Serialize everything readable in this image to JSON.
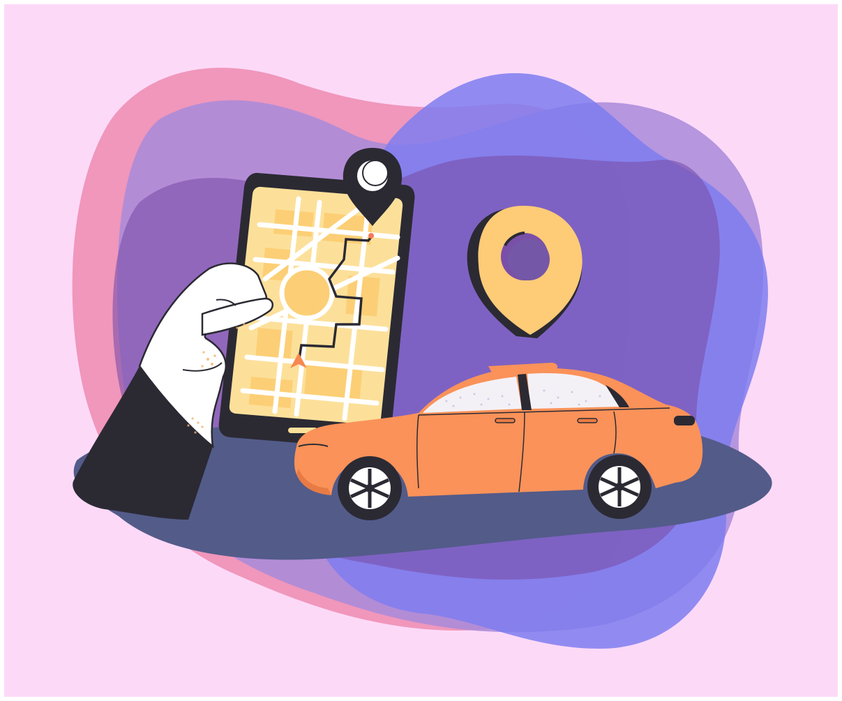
{
  "illustration": {
    "subject": "taxi-ride-navigation",
    "icons": [
      "map-pin-icon",
      "location-pin-icon",
      "navigation-arrow-icon"
    ]
  },
  "colors": {
    "background": "#FDD9F8",
    "frame": "#FFFFFF",
    "blob_pink": "#EE8FB4",
    "blob_violet": "#A889DA",
    "blob_blue": "#7E7DF0",
    "blob_purple": "#7A4FA8",
    "road": "#535B89",
    "phone_body": "#2B2A33",
    "phone_screen": "#FCE09A",
    "map_block": "#FCCF76",
    "route_line": "#2B2A33",
    "map_pin_dark": "#2B2A33",
    "location_pin": "#FECB77",
    "hand": "#FFFFFF",
    "sleeve": "#2B2A33",
    "car_body": "#FA9259",
    "car_shade": "#E87B45",
    "window": "#F4F1F6",
    "tire": "#2B2A33",
    "rim": "#FFFFFF",
    "arrow": "#F7884F"
  }
}
